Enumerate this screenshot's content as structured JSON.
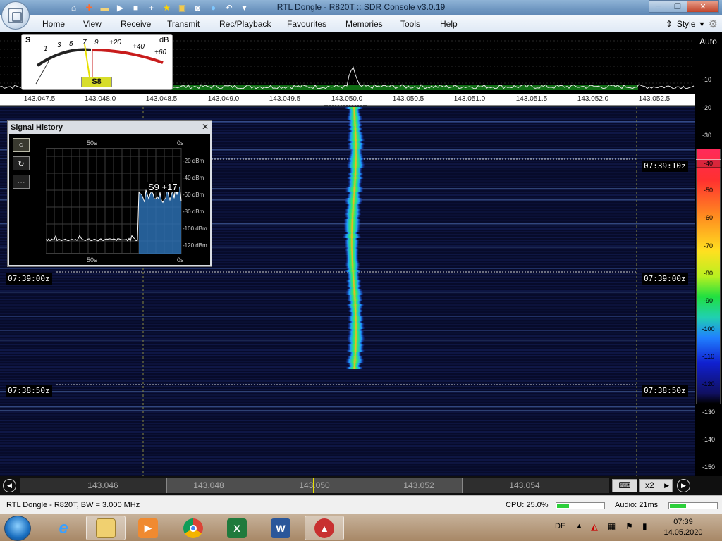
{
  "window": {
    "title": "RTL Dongle - R820T :: SDR Console v3.0.19",
    "minimize_label": "─",
    "maximize_label": "❐",
    "close_label": "✕"
  },
  "quick_access": [
    "home-icon",
    "lifebuoy-icon",
    "folder-icon",
    "play-icon",
    "stop-icon",
    "add-icon",
    "star-icon",
    "lock-icon",
    "camera-icon",
    "water-drop-icon",
    "undo-icon",
    "dropdown-icon"
  ],
  "menu": {
    "items": [
      "Home",
      "View",
      "Receive",
      "Transmit",
      "Rec/Playback",
      "Favourites",
      "Memories",
      "Tools",
      "Help"
    ],
    "style_label": "Style"
  },
  "smeter": {
    "s_label": "S",
    "db_label": "dB",
    "scale": [
      "1",
      "3",
      "5",
      "7",
      "9",
      "+20",
      "+40",
      "+60"
    ],
    "reading": "S8"
  },
  "spectrum": {
    "freq_ticks": [
      "143.047.5",
      "143.048.0",
      "143.048.5",
      "143.049.0",
      "143.049.5",
      "143.050.0",
      "143.050.5",
      "143.051.0",
      "143.051.5",
      "143.052.0",
      "143.052.5"
    ],
    "auto_label": "Auto",
    "db_ticks": [
      "-10",
      "-20",
      "-30"
    ]
  },
  "colorbar": {
    "labels": [
      "-40",
      "-50",
      "-60",
      "-70",
      "-80",
      "-90",
      "-100",
      "-110",
      "-120"
    ],
    "below_ticks": [
      "-130",
      "-140",
      "-150"
    ]
  },
  "waterfall": {
    "time_labels_left": [
      "07:39:00z",
      "07:38:50z"
    ],
    "time_labels_right": [
      "07:39:10z",
      "07:39:00z",
      "07:38:50z"
    ]
  },
  "signal_history": {
    "title": "Signal History",
    "close_label": "✕",
    "buttons": [
      "○",
      "↻",
      "⋯"
    ],
    "top_time_left": "50s",
    "top_time_right": "0s",
    "bottom_time_left": "50s",
    "bottom_time_right": "0s",
    "db_labels": [
      "-20 dBm",
      "-40 dBm",
      "-60 dBm",
      "-80 dBm",
      "-100 dBm",
      "-120 dBm"
    ],
    "reading": "S9 +17",
    "trace_level": {
      "before": "-120",
      "after_min": "-75",
      "after_max": "-55"
    }
  },
  "tuning": {
    "freqs": [
      "143.046",
      "143.048",
      "143.050",
      "143.052",
      "143.054"
    ],
    "zoom_label": "x2"
  },
  "status": {
    "device": "RTL Dongle - R820T, BW = 3.000 MHz",
    "cpu_label": "CPU: 25.0%",
    "cpu_fraction": 0.25,
    "audio_label": "Audio: 21ms",
    "audio_fraction": 0.35
  },
  "taskbar": {
    "apps": [
      "internet-explorer-icon",
      "file-explorer-icon",
      "media-player-icon",
      "chrome-icon",
      "excel-icon",
      "word-icon",
      "sdr-console-icon"
    ],
    "language": "DE",
    "time": "07:39",
    "date": "14.05.2020"
  },
  "colors": {
    "waterfall_bg": "#070b2a",
    "signal_core": "#ff9020",
    "accent_green": "#2ccf3a"
  }
}
